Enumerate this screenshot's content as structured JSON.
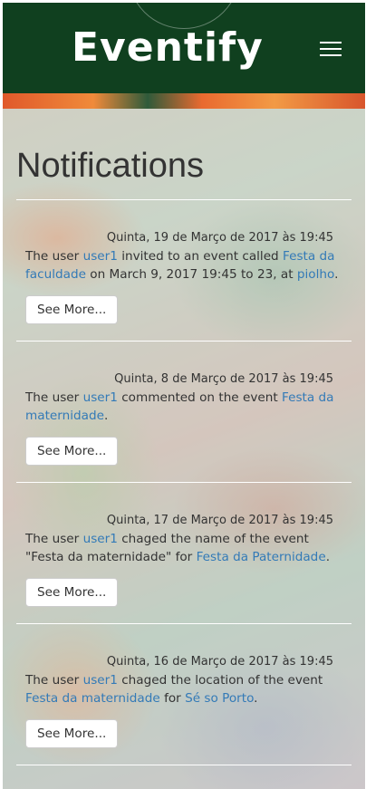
{
  "navbar": {
    "brand": "Eventify"
  },
  "page": {
    "title": "Notifications",
    "see_more_label": "See More..."
  },
  "notifications": [
    {
      "date": "Quinta, 19 de Março de 2017 às 19:45",
      "t1": "The user ",
      "user": "user1",
      "t2": " invited to an event called ",
      "event": "Festa da faculdade",
      "t3": " on March 9, 2017 19:45 to 23, at ",
      "extra": "piolho",
      "t4": "."
    },
    {
      "date": "Quinta, 8 de Março de 2017 às 19:45",
      "t1": "The user ",
      "user": "user1",
      "t2": " commented on the event ",
      "event": "Festa da maternidade",
      "t3": ".",
      "extra": "",
      "t4": ""
    },
    {
      "date": "Quinta, 17 de Março de 2017 às 19:45",
      "t1": "The user ",
      "user": "user1",
      "t2": " chaged the name of the event \"Festa da maternidade\" for ",
      "event": "Festa da Paternidade",
      "t3": ".",
      "extra": "",
      "t4": ""
    },
    {
      "date": "Quinta, 16 de Março de 2017 às 19:45",
      "t1": "The user ",
      "user": "user1",
      "t2": " chaged the location of the event ",
      "event": "Festa da maternidade",
      "t3": " for ",
      "extra": "Sé so Porto",
      "t4": "."
    }
  ]
}
